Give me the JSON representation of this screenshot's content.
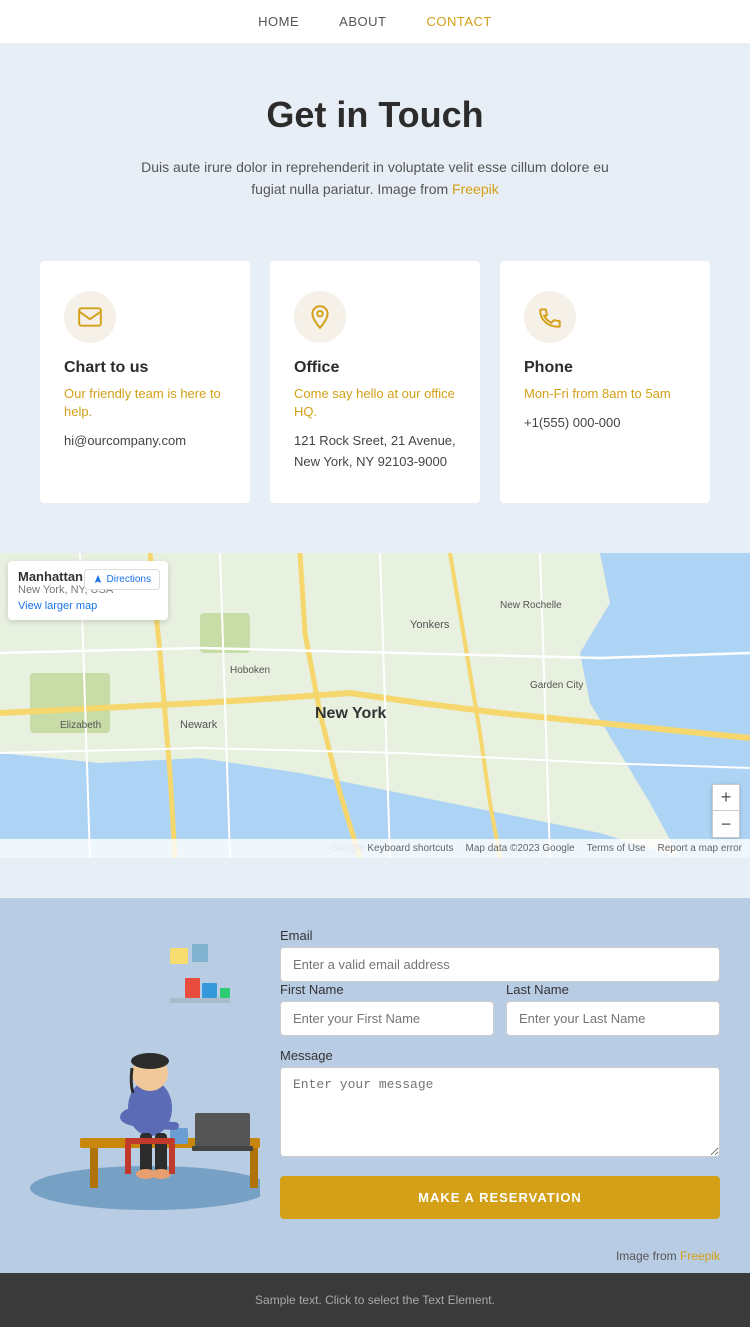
{
  "nav": {
    "items": [
      {
        "label": "HOME",
        "active": false
      },
      {
        "label": "ABOUT",
        "active": false
      },
      {
        "label": "CONTACT",
        "active": true
      }
    ]
  },
  "hero": {
    "title": "Get in Touch",
    "description": "Duis aute irure dolor in reprehenderit in voluptate velit esse cillum dolore eu fugiat nulla pariatur. Image from",
    "freepik_label": "Freepik"
  },
  "cards": [
    {
      "icon": "email",
      "title": "Chart to us",
      "subtitle": "Our friendly team is here to help.",
      "info": "hi@ourcompany.com",
      "link": null
    },
    {
      "icon": "location",
      "title": "Office",
      "subtitle": "Come say hello at our office HQ.",
      "info": "121 Rock Sreet, 21 Avenue,\nNew York, NY 92103-9000",
      "link": null
    },
    {
      "icon": "phone",
      "title": "Phone",
      "subtitle": "Mon-Fri from 8am to 5am",
      "info": "+1(555) 000-000",
      "link": null
    }
  ],
  "map": {
    "place_name": "Manhattan",
    "place_sub": "New York, NY, USA",
    "directions_label": "Directions",
    "view_larger_label": "View larger map",
    "zoom_in": "+",
    "zoom_out": "−",
    "footer_items": [
      "Keyboard shortcuts",
      "Map data ©2023 Google",
      "Terms of Use",
      "Report a map error"
    ]
  },
  "form": {
    "email_label": "Email",
    "email_placeholder": "Enter a valid email address",
    "firstname_label": "First Name",
    "firstname_placeholder": "Enter your First Name",
    "lastname_label": "Last Name",
    "lastname_placeholder": "Enter your Last Name",
    "message_label": "Message",
    "message_placeholder": "Enter your message",
    "submit_label": "MAKE A RESERVATION",
    "image_credit": "Image from",
    "freepik_label": "Freepik"
  },
  "footer": {
    "text": "Sample text. Click to select the Text Element."
  }
}
